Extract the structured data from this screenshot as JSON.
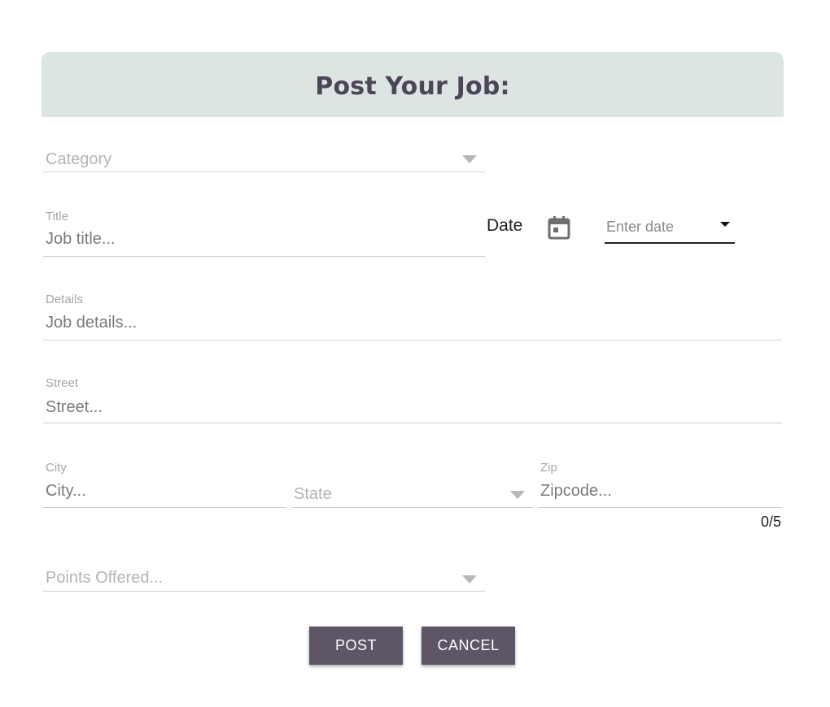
{
  "header": {
    "title": "Post Your Job:"
  },
  "form": {
    "category": {
      "placeholder": "Category"
    },
    "title": {
      "label": "Title",
      "placeholder": "Job title..."
    },
    "date": {
      "label": "Date",
      "placeholder": "Enter date"
    },
    "details": {
      "label": "Details",
      "placeholder": "Job details..."
    },
    "street": {
      "label": "Street",
      "placeholder": "Street..."
    },
    "city": {
      "label": "City",
      "placeholder": "City..."
    },
    "state": {
      "placeholder": "State"
    },
    "zip": {
      "label": "Zip",
      "placeholder": "Zipcode...",
      "counter": "0/5"
    },
    "points": {
      "placeholder": "Points Offered..."
    }
  },
  "actions": {
    "post_label": "POST",
    "cancel_label": "CANCEL"
  },
  "colors": {
    "header_bg": "#dde5e3",
    "header_text": "#4d4658",
    "button_bg": "#5e5567",
    "button_text": "#ffffff"
  },
  "icons": {
    "date": "calendar-icon",
    "select": "chevron-down-icon"
  }
}
